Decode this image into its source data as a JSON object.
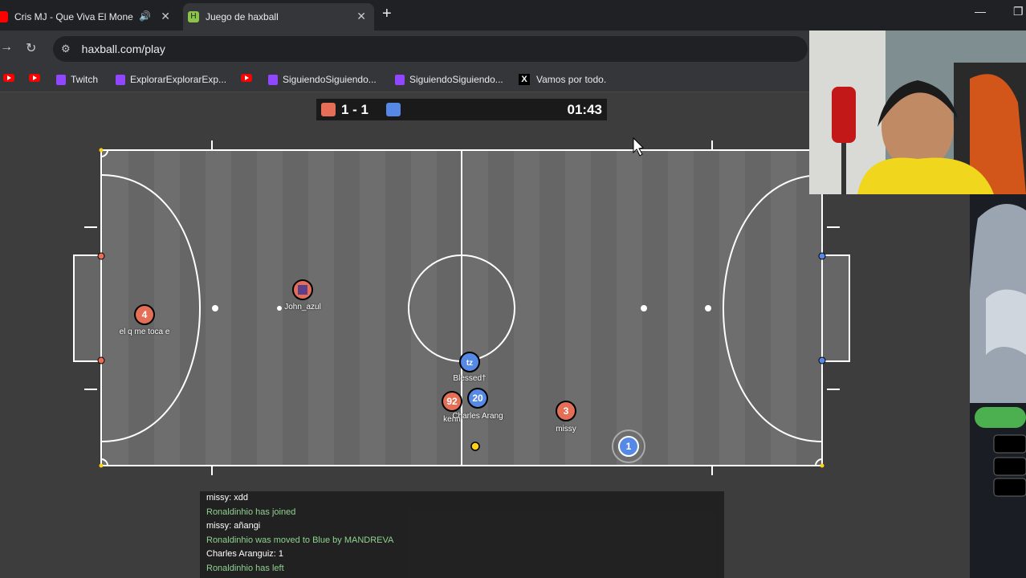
{
  "browser": {
    "tabs": [
      {
        "title": "Cris MJ - Que Viva El Mone",
        "active": false,
        "has_audio": true
      },
      {
        "title": "Juego de haxball",
        "active": true,
        "has_audio": false
      }
    ],
    "url": "haxball.com/play",
    "bookmarks": [
      {
        "icon": "youtube-icon",
        "label": ""
      },
      {
        "icon": "youtube-icon",
        "label": ""
      },
      {
        "icon": "twitch-icon",
        "label": "Twitch"
      },
      {
        "icon": "twitch-icon",
        "label": "ExplorarExplorarExp..."
      },
      {
        "icon": "youtube-icon",
        "label": ""
      },
      {
        "icon": "twitch-icon",
        "label": "SiguiendoSiguiendo..."
      },
      {
        "icon": "twitch-icon",
        "label": "SiguiendoSiguiendo..."
      },
      {
        "icon": "x-icon",
        "label": "Vamos por todo."
      }
    ]
  },
  "scoreboard": {
    "red_score": "1",
    "separator": "-",
    "blue_score": "1",
    "score_text": "1 - 1",
    "time": "01:43",
    "red_color": "#e56e56",
    "blue_color": "#5689e5"
  },
  "players": [
    {
      "team": "red",
      "number": "4",
      "name": "el q me toca e"
    },
    {
      "team": "red",
      "number": "",
      "name": "John_azul",
      "avatar_icon": "pixel-avatar-icon"
    },
    {
      "team": "blue",
      "number": "tz",
      "name": "Blessed†"
    },
    {
      "team": "red",
      "number": "92",
      "name": "kenn"
    },
    {
      "team": "blue",
      "number": "20",
      "name": "Charles Arang"
    },
    {
      "team": "red",
      "number": "3",
      "name": "missy"
    },
    {
      "team": "blue",
      "number": "1",
      "name": ""
    }
  ],
  "chat": [
    {
      "text": "missy: xdd",
      "type": "message"
    },
    {
      "text": "Ronaldinhio has joined",
      "type": "notice"
    },
    {
      "text": "missy: añangi",
      "type": "message"
    },
    {
      "text": "Ronaldinhio was moved to Blue by MANDREVA",
      "type": "notice"
    },
    {
      "text": "Charles Aranguiz: 1",
      "type": "message"
    },
    {
      "text": "Ronaldinhio has left",
      "type": "notice"
    }
  ],
  "colors": {
    "pitch": "#6b6b6b",
    "line": "#ffffff",
    "ball": "#ffd21a",
    "notice_text": "#8ed28e",
    "message_text": "#ffffff"
  }
}
